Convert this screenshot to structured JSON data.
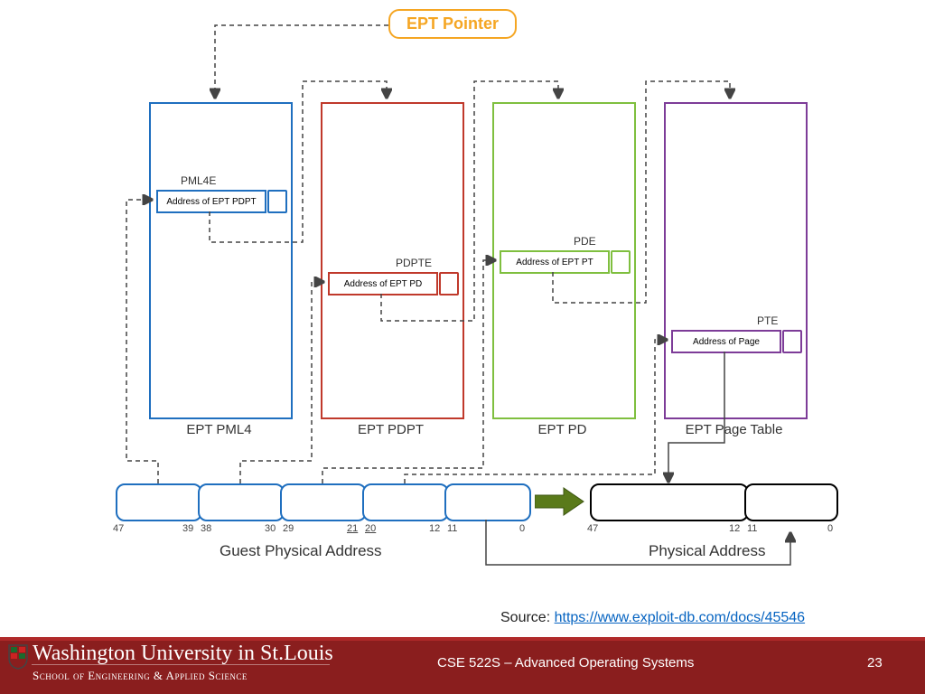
{
  "pointer": {
    "label": "EPT Pointer"
  },
  "tables": {
    "pml4": {
      "label": "EPT PML4",
      "entry_label": "PML4E",
      "entry_text": "Address of EPT PDPT",
      "color": "#1f6fbf"
    },
    "pdpt": {
      "label": "EPT PDPT",
      "entry_label": "PDPTE",
      "entry_text": "Address of EPT PD",
      "color": "#c0392b"
    },
    "pd": {
      "label": "EPT PD",
      "entry_label": "PDE",
      "entry_text": "Address of EPT PT",
      "color": "#7fbf3f"
    },
    "pt": {
      "label": "EPT Page Table",
      "entry_label": "PTE",
      "entry_text": "Address of Page",
      "color": "#7d3c98"
    }
  },
  "gpa": {
    "label": "Guest Physical Address",
    "bits": [
      "47",
      "39",
      "38",
      "30",
      "29",
      "21",
      "20",
      "12",
      "11",
      "0"
    ]
  },
  "pa": {
    "label": "Physical Address",
    "bits": [
      "47",
      "12",
      "11",
      "0"
    ]
  },
  "source": {
    "prefix": "Source: ",
    "url_text": "https://www.exploit-db.com/docs/45546"
  },
  "footer": {
    "uni_top": "Washington University in St.Louis",
    "uni_bottom": "School of Engineering & Applied Science",
    "course": "CSE 522S – Advanced Operating Systems",
    "page": "23"
  }
}
